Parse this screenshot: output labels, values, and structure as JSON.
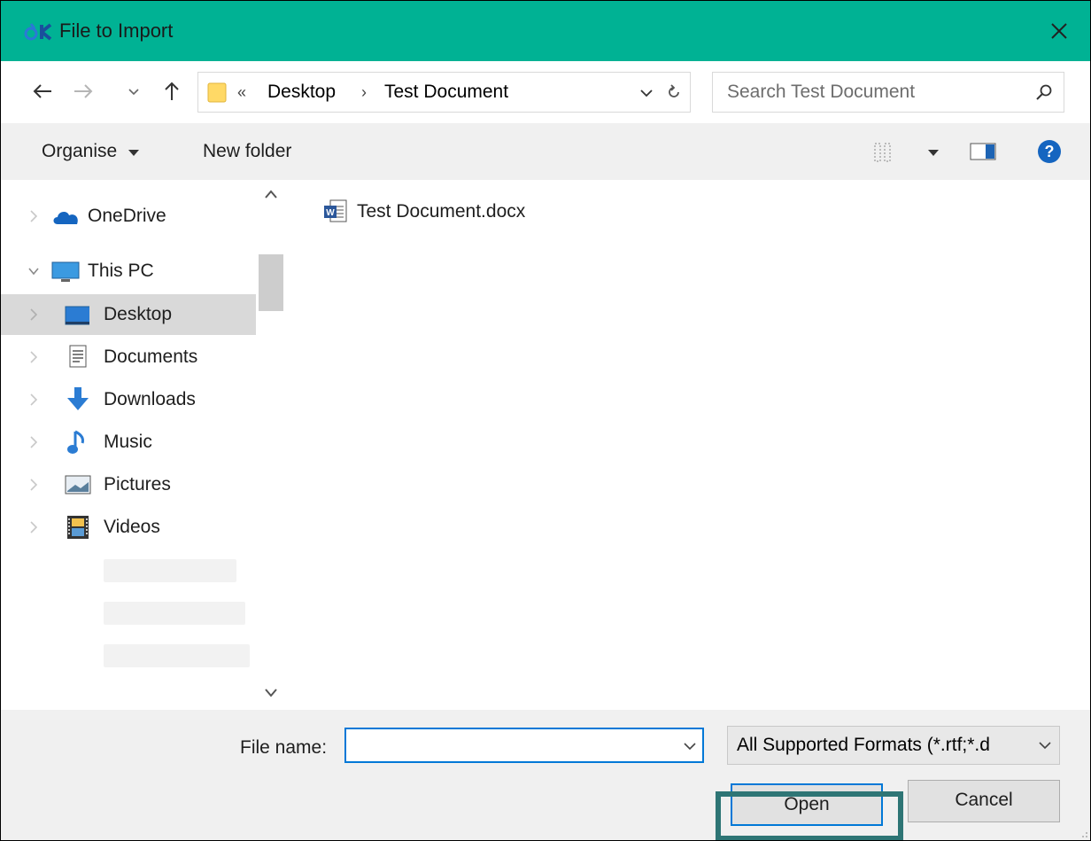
{
  "window": {
    "title": "File to Import",
    "accent_color": "#00b294",
    "app_icon": "app-logo-icon",
    "close_icon": "close-icon"
  },
  "navigation": {
    "back_icon": "back-arrow-icon",
    "forward_icon": "forward-arrow-icon",
    "recent_icon": "chevron-down-icon",
    "up_icon": "up-arrow-icon"
  },
  "address_bar": {
    "overflow_glyph": "«",
    "breadcrumbs": [
      "Desktop",
      "Test Document"
    ],
    "separator": "›",
    "refresh_icon": "refresh-icon"
  },
  "search": {
    "placeholder": "Search Test Document",
    "icon": "search-icon"
  },
  "toolbar": {
    "organise_label": "Organise",
    "new_folder_label": "New folder",
    "view_icon": "view-options-icon",
    "preview_icon": "preview-pane-icon",
    "help_icon": "help-icon"
  },
  "sidebar": {
    "items": [
      {
        "label": "OneDrive",
        "icon": "onedrive-cloud-icon"
      },
      {
        "label": "This PC",
        "icon": "computer-icon"
      },
      {
        "label": "Desktop",
        "icon": "desktop-icon",
        "selected": true
      },
      {
        "label": "Documents",
        "icon": "documents-icon"
      },
      {
        "label": "Downloads",
        "icon": "downloads-icon"
      },
      {
        "label": "Music",
        "icon": "music-icon"
      },
      {
        "label": "Pictures",
        "icon": "pictures-icon"
      },
      {
        "label": "Videos",
        "icon": "videos-icon"
      }
    ]
  },
  "files": [
    {
      "name": "Test Document.docx",
      "icon": "word-document-icon"
    }
  ],
  "footer": {
    "file_name_label": "File name:",
    "file_name_value": "",
    "file_type_value": "All Supported Formats (*.rtf;*.d",
    "open_label": "Open",
    "cancel_label": "Cancel",
    "highlight_color": "#2e7575"
  }
}
